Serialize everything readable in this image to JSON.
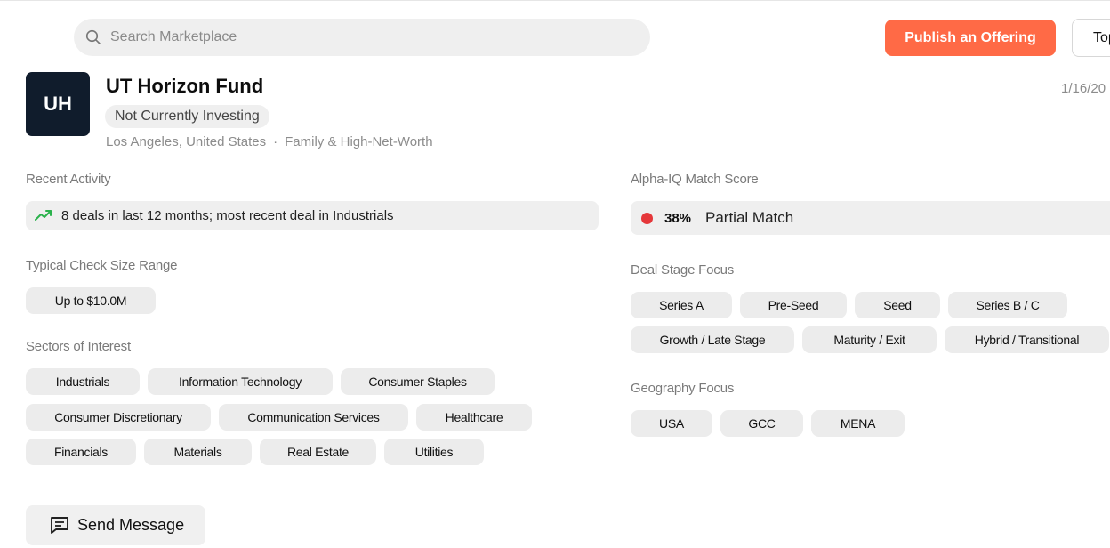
{
  "topbar": {
    "search_placeholder": "Search Marketplace",
    "publish_label": "Publish an Offering",
    "top_button_label": "Top"
  },
  "fund": {
    "initials": "UH",
    "name": "UT Horizon Fund",
    "status": "Not Currently Investing",
    "location": "Los Angeles, United States",
    "separator": "·",
    "investor_type": "Family & High-Net-Worth",
    "date": "1/16/20"
  },
  "recent_activity": {
    "label": "Recent Activity",
    "text": "8 deals in last 12 months; most recent deal in Industrials",
    "icon": "trending-up-icon"
  },
  "check_size": {
    "label": "Typical Check Size Range",
    "value": "Up to $10.0M"
  },
  "sectors": {
    "label": "Sectors of Interest",
    "items": [
      "Industrials",
      "Information Technology",
      "Consumer Staples",
      "Consumer Discretionary",
      "Communication Services",
      "Healthcare",
      "Financials",
      "Materials",
      "Real Estate",
      "Utilities"
    ]
  },
  "match_score": {
    "label": "Alpha-IQ Match Score",
    "percent": "38%",
    "description": "Partial Match",
    "dot_color": "#e5373a"
  },
  "deal_stage": {
    "label": "Deal Stage Focus",
    "items": [
      "Series A",
      "Pre-Seed",
      "Seed",
      "Series B / C",
      "Growth / Late Stage",
      "Maturity / Exit",
      "Hybrid / Transitional"
    ]
  },
  "geography": {
    "label": "Geography Focus",
    "items": [
      "USA",
      "GCC",
      "MENA"
    ]
  },
  "actions": {
    "send_message_label": "Send Message"
  },
  "colors": {
    "accent": "#ff6a46",
    "avatar_bg": "#101c2c",
    "trend_green": "#2bb24c"
  }
}
